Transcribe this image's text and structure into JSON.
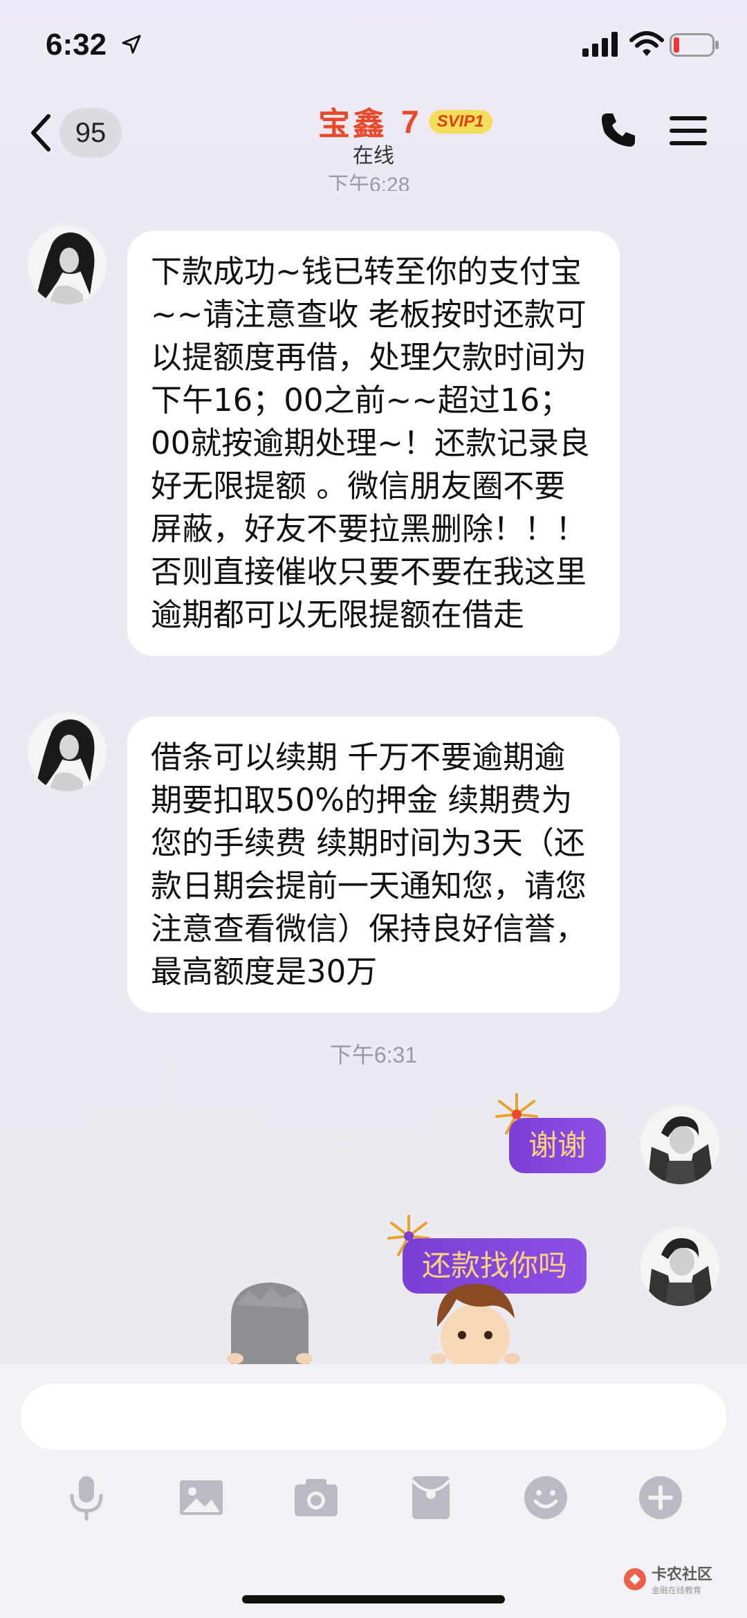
{
  "status_bar": {
    "time": "6:32"
  },
  "nav": {
    "back_count": "95",
    "contact_name": "宝鑫",
    "level": "7",
    "badge": "SVIP1",
    "status": "在线"
  },
  "chat": {
    "cut_timestamp": "下午6:28",
    "messages": [
      {
        "side": "left",
        "text": "下款成功~钱已转至你的支付宝~~请注意查收 老板按时还款可以提额度再借，处理欠款时间为下午16；00之前~~超过16；00就按逾期处理~！还款记录良好无限提额 。微信朋友圈不要屏蔽，好友不要拉黑删除！！！ 否则直接催收只要不要在我这里逾期都可以无限提额在借走"
      },
      {
        "side": "left",
        "text": "借条可以续期 千万不要逾期逾期要扣取50%的押金 续期费为您的手续费 续期时间为3天（还款日期会提前一天通知您，请您注意查看微信）保持良好信誉，最高额度是30万"
      }
    ],
    "timestamp": "下午6:31",
    "sent": [
      {
        "text": "谢谢"
      },
      {
        "text": "还款找你吗"
      }
    ]
  },
  "input": {
    "placeholder": ""
  },
  "toolbar": {
    "icons": [
      "microphone-icon",
      "image-icon",
      "camera-icon",
      "red-packet-icon",
      "emoji-icon",
      "plus-icon"
    ]
  },
  "watermark": {
    "title": "卡农社区",
    "subtitle": "金融在线教育"
  },
  "colors": {
    "name_accent": "#e8492b",
    "svip_bg": "#f7dd5c",
    "vip_bubble": "#7b3fd6",
    "vip_text": "#fdd37c",
    "bg": "#ebeaf1"
  }
}
